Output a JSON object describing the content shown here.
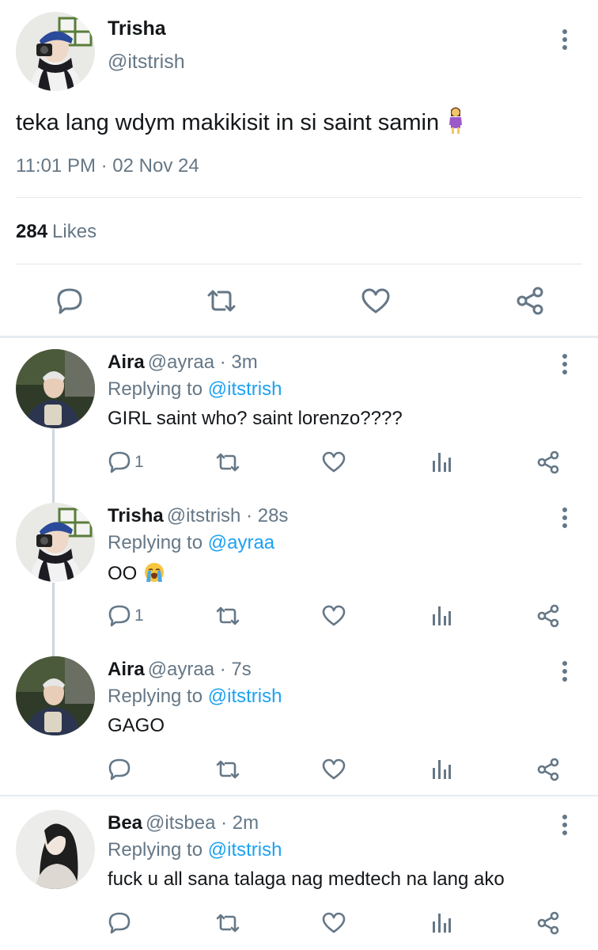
{
  "main_tweet": {
    "name": "Trisha",
    "handle": "@itstrish",
    "text": "teka lang wdym makikisit in si saint samin",
    "emoji": "woman-standing-emoji",
    "timestamp": "11:01 PM · 02 Nov 24",
    "likes_count": "284",
    "likes_label": "Likes",
    "actions": [
      "reply-icon",
      "retweet-icon",
      "like-icon",
      "share-icon"
    ]
  },
  "replies": [
    {
      "name": "Aira",
      "meta": "@ayraa · 3m",
      "replying_prefix": "Replying to",
      "replying_to": "@itstrish",
      "text": "GIRL saint who? saint lorenzo????",
      "reply_count": "1"
    },
    {
      "name": "Trisha",
      "meta": "@itstrish · 28s",
      "replying_prefix": "Replying to",
      "replying_to": "@ayraa",
      "text": "OO",
      "emoji": "loudly-crying-face-emoji",
      "reply_count": "1"
    },
    {
      "name": "Aira",
      "meta": "@ayraa · 7s",
      "replying_prefix": "Replying to",
      "replying_to": "@itstrish",
      "text": "GAGO",
      "reply_count": ""
    },
    {
      "name": "Bea",
      "meta": "@itsbea · 2m",
      "replying_prefix": "Replying to",
      "replying_to": "@itstrish",
      "text": "fuck u all sana talaga nag medtech na lang ako",
      "reply_count": ""
    }
  ],
  "colors": {
    "primary_text": "#14171a",
    "secondary_text": "#657786",
    "mention": "#1da1f2",
    "divider": "#e1e8ed",
    "thread_line": "#ccd6dd"
  }
}
